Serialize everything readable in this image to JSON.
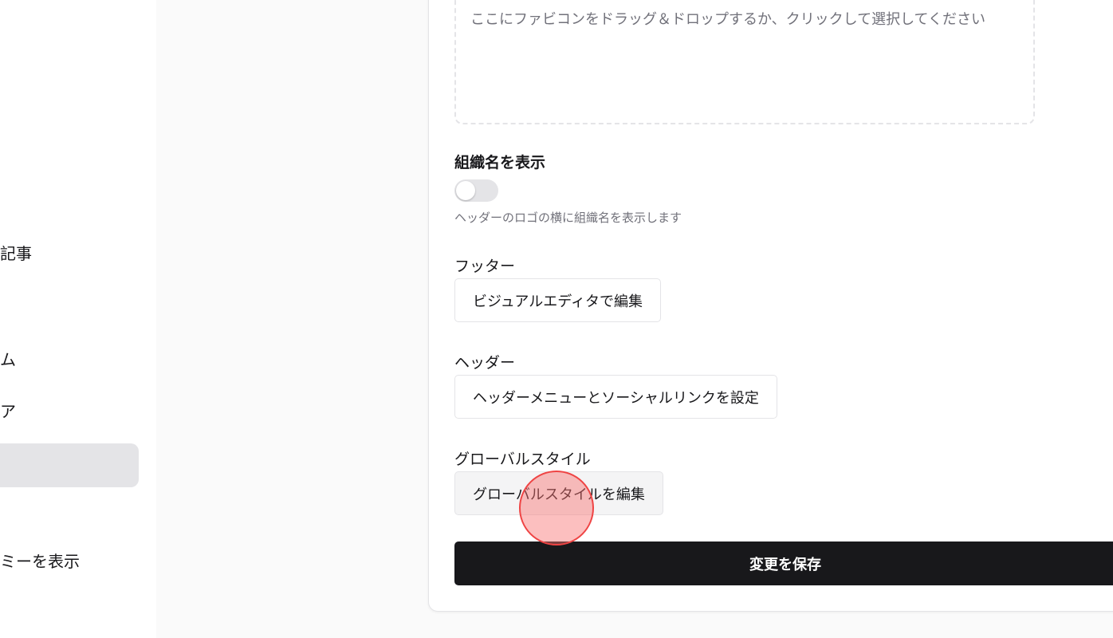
{
  "sidebar": {
    "items": [
      {
        "label": "記事"
      },
      {
        "label": "ム"
      },
      {
        "label": "ア"
      },
      {
        "label": ""
      },
      {
        "label": "ミーを表示"
      }
    ]
  },
  "favicon_upload": {
    "placeholder": "ここにファビコンをドラッグ＆ドロップするか、クリックして選択してください"
  },
  "show_org_name": {
    "label": "組織名を表示",
    "hint": "ヘッダーのロゴの横に組織名を表示します",
    "enabled": false
  },
  "footer": {
    "label": "フッター",
    "button": "ビジュアルエディタで編集"
  },
  "header": {
    "label": "ヘッダー",
    "button": "ヘッダーメニューとソーシャルリンクを設定"
  },
  "global_style": {
    "label": "グローバルスタイル",
    "button": "グローバルスタイルを編集"
  },
  "save_button": "変更を保存",
  "colors": {
    "primary": "#18181b",
    "muted_text": "#71717a",
    "border": "#e4e4e7",
    "click_marker": "#ef4444"
  }
}
